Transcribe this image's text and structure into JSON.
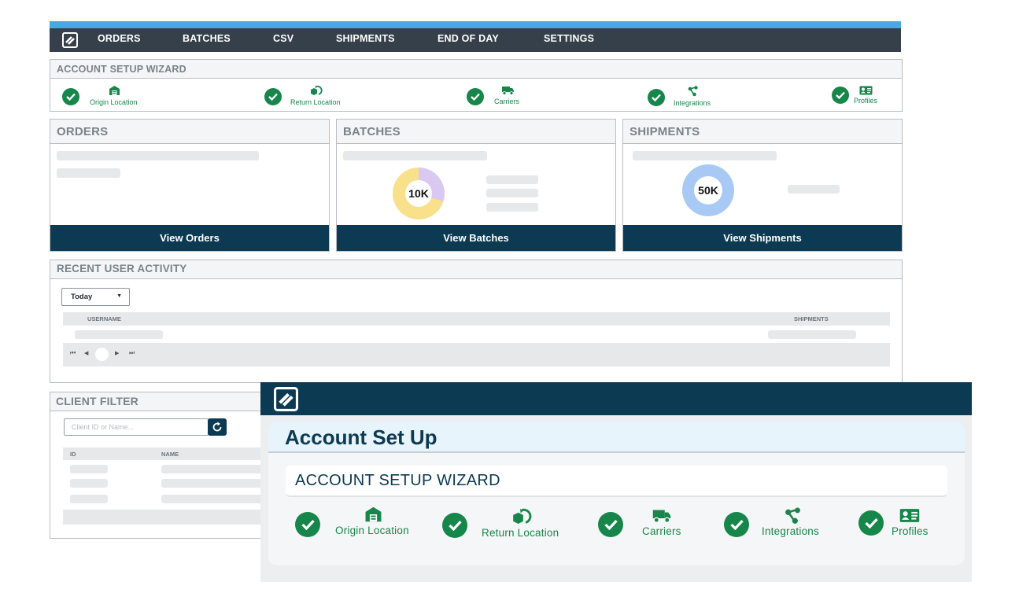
{
  "nav": {
    "items": [
      "ORDERS",
      "BATCHES",
      "CSV",
      "SHIPMENTS",
      "END OF DAY",
      "SETTINGS"
    ],
    "accent_color": "#4aa8e0",
    "bar_color": "#36404a"
  },
  "wizard": {
    "title": "ACCOUNT SETUP WIZARD",
    "steps": [
      {
        "label": "Origin Location",
        "icon": "warehouse-icon"
      },
      {
        "label": "Return Location",
        "icon": "return-box-icon"
      },
      {
        "label": "Carriers",
        "icon": "truck-icon"
      },
      {
        "label": "Integrations",
        "icon": "share-nodes-icon"
      },
      {
        "label": "Profiles",
        "icon": "id-card-icon"
      }
    ]
  },
  "cards": {
    "orders": {
      "title": "ORDERS",
      "button": "View Orders"
    },
    "batches": {
      "title": "BATCHES",
      "donut_value": "10K",
      "button": "View Batches"
    },
    "shipments": {
      "title": "SHIPMENTS",
      "donut_value": "50K",
      "button": "View Shipments"
    }
  },
  "activity": {
    "title": "RECENT USER ACTIVITY",
    "filter_value": "Today",
    "columns": [
      "USERNAME",
      "SHIPMENTS"
    ]
  },
  "client_filter": {
    "title": "CLIENT FILTER",
    "search_placeholder": "Client ID or Name...",
    "columns": [
      "ID",
      "NAME"
    ]
  },
  "overlay": {
    "title": "Account Set Up",
    "wizard_title": "ACCOUNT SETUP WIZARD",
    "steps": [
      {
        "label": "Origin Location",
        "icon": "warehouse-icon"
      },
      {
        "label": "Return Location",
        "icon": "return-box-icon"
      },
      {
        "label": "Carriers",
        "icon": "truck-icon"
      },
      {
        "label": "Integrations",
        "icon": "share-nodes-icon"
      },
      {
        "label": "Profiles",
        "icon": "id-card-icon"
      }
    ]
  },
  "colors": {
    "primary_dark": "#0b3a52",
    "success_green": "#17864a",
    "batches_donut": [
      "#d9c8f2",
      "#f9e08a"
    ],
    "shipments_donut": "#a9c9f5"
  }
}
